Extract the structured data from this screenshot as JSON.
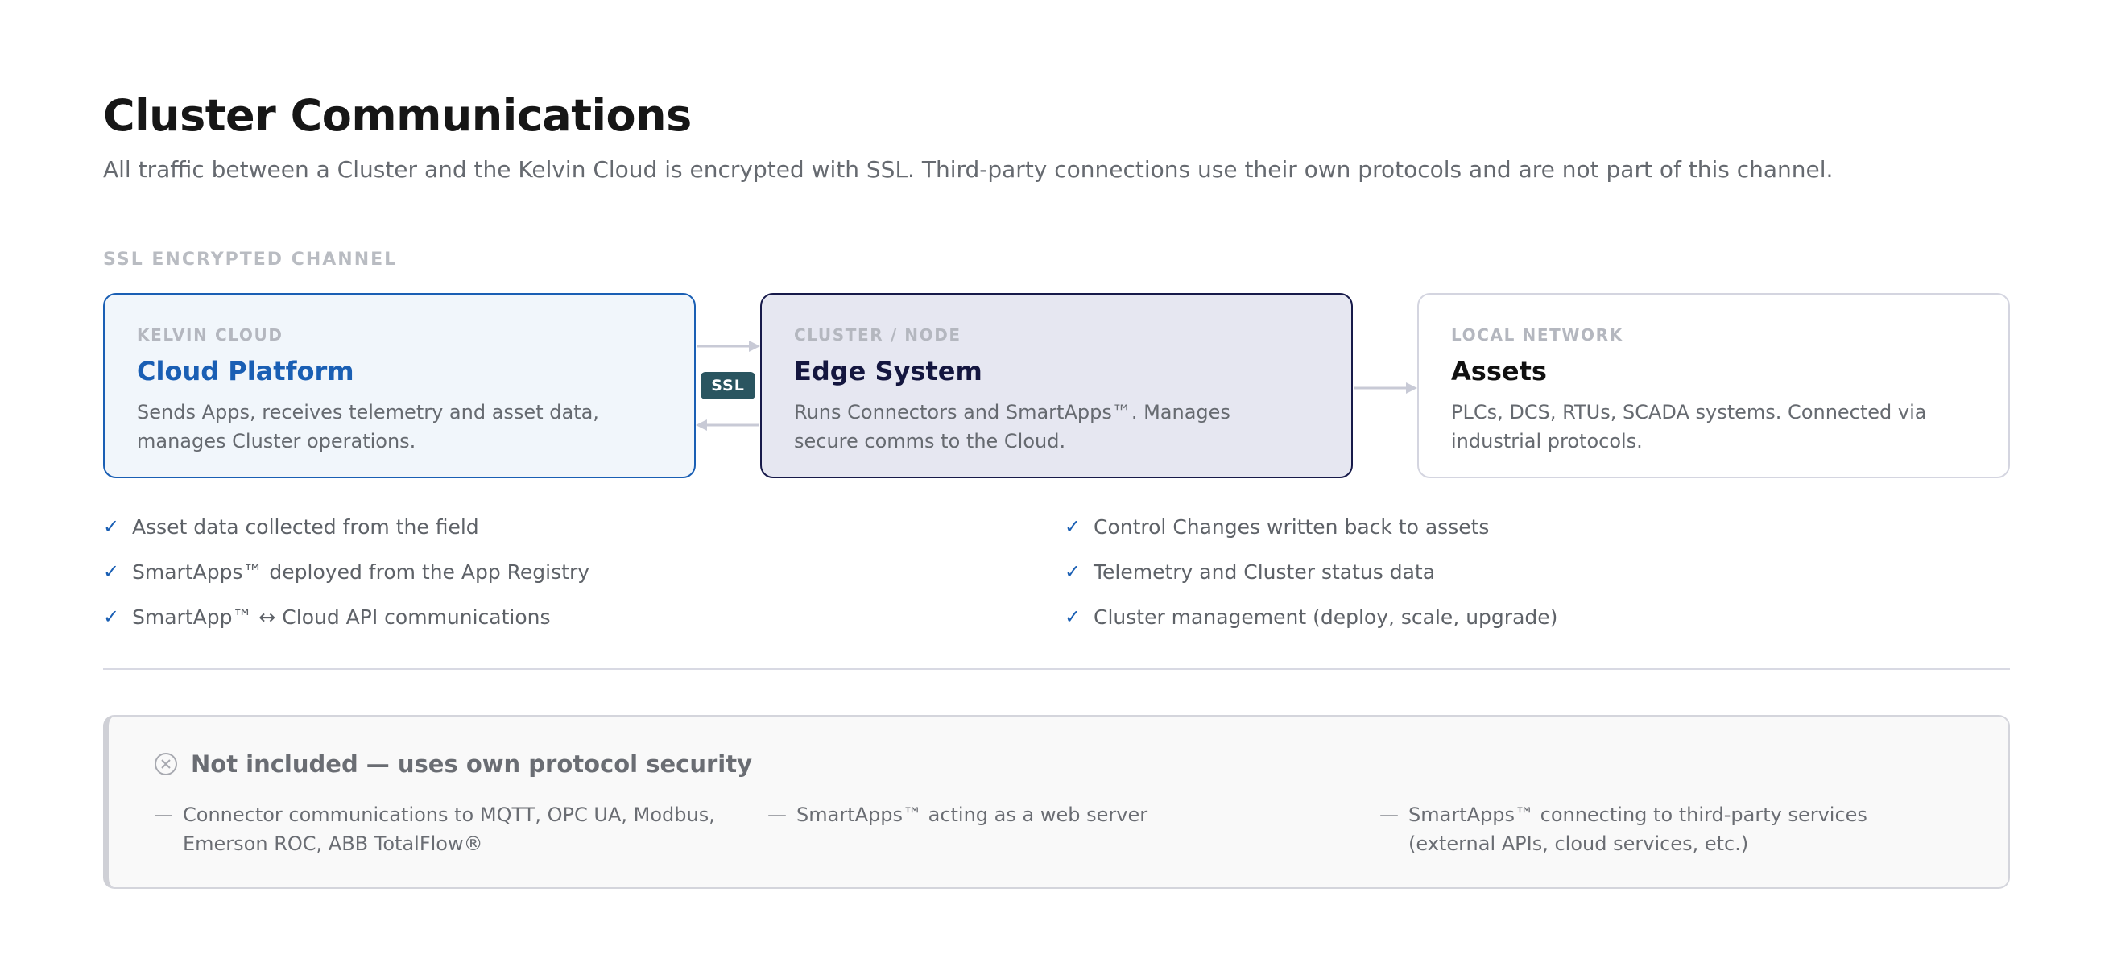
{
  "header": {
    "title": "Cluster Communications",
    "subtitle": "All traffic between a Cluster and the Kelvin Cloud is encrypted with SSL. Third-party connections use their own protocols and are not part of this channel."
  },
  "channel_label": "SSL ENCRYPTED CHANNEL",
  "nodes": [
    {
      "eyebrow": "KELVIN CLOUD",
      "title": "Cloud Platform",
      "desc": "Sends Apps, receives telemetry and asset data, manages Cluster operations."
    },
    {
      "eyebrow": "CLUSTER / NODE",
      "title": "Edge System",
      "desc": "Runs Connectors and SmartApps™. Manages secure comms to the Cloud."
    },
    {
      "eyebrow": "LOCAL NETWORK",
      "title": "Assets",
      "desc": "PLCs, DCS, RTUs, SCADA systems. Connected via industrial protocols."
    }
  ],
  "ssl_badge": "SSL",
  "check_mark": "✓",
  "checks_left": [
    "Asset data collected from the field",
    "SmartApps™ deployed from the App Registry",
    "SmartApp™ ↔ Cloud API communications"
  ],
  "checks_right": [
    "Control Changes written back to assets",
    "Telemetry and Cluster status data",
    "Cluster management (deploy, scale, upgrade)"
  ],
  "excluded": {
    "title": "Not included — uses own protocol security",
    "dash": "—",
    "items": [
      "Connector communications to MQTT, OPC UA, Modbus, Emerson ROC, ABB TotalFlow®",
      "SmartApps™ acting as a web server",
      "SmartApps™ connecting to third-party services (external APIs, cloud services, etc.)"
    ]
  },
  "colors": {
    "accent": "#1a5fb4",
    "edge": "#14163f",
    "ssl_badge": "#2a5560",
    "connector": "#c8cad6"
  }
}
